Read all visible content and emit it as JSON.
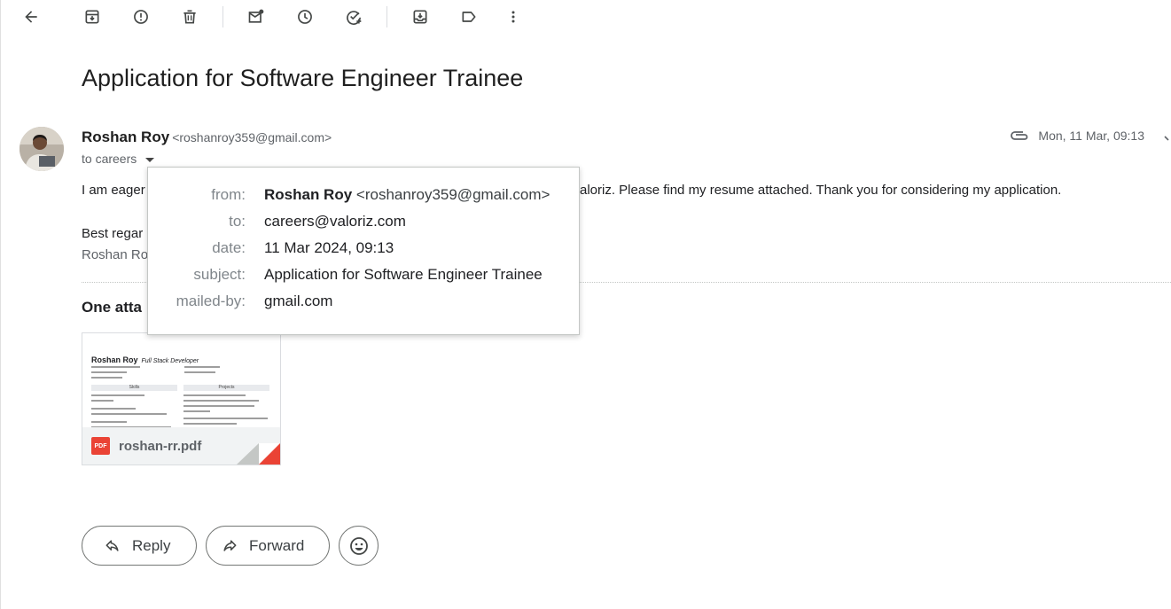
{
  "toolbar": {
    "icons": [
      "back-arrow-icon",
      "archive-icon",
      "report-spam-icon",
      "delete-icon",
      "mark-unread-icon",
      "snooze-icon",
      "add-task-icon",
      "move-to-icon",
      "label-icon",
      "more-vert-icon"
    ]
  },
  "email": {
    "subject": "Application for Software Engineer Trainee",
    "sender_name": "Roshan Roy",
    "sender_email": "<roshanroy359@gmail.com>",
    "to_text": "to careers",
    "date": "Mon, 11 Mar, 09:13",
    "body_left": "I am eager",
    "body_right": "aloriz. Please find my resume attached. Thank you for considering my application.",
    "closing": "Best regar",
    "signature": "Roshan Ro"
  },
  "details": {
    "from_label": "from:",
    "from_name": "Roshan Roy",
    "from_email": "<roshanroy359@gmail.com>",
    "to_label": "to:",
    "to_value": "careers@valoriz.com",
    "date_label": "date:",
    "date_value": "11 Mar 2024, 09:13",
    "subject_label": "subject:",
    "subject_value": "Application for Software Engineer Trainee",
    "mailedby_label": "mailed-by:",
    "mailedby_value": "gmail.com"
  },
  "attachments": {
    "heading": "One atta",
    "file_name": "roshan-rr.pdf",
    "file_type": "PDF",
    "preview": {
      "name": "Roshan Roy",
      "role": "Full Stack Developer",
      "col1_head": "Skills",
      "col2_head": "Projects"
    }
  },
  "actions": {
    "reply_label": "Reply",
    "forward_label": "Forward"
  },
  "colors": {
    "pdf_red": "#ea4335",
    "text": "#202124",
    "muted": "#5f6368"
  }
}
